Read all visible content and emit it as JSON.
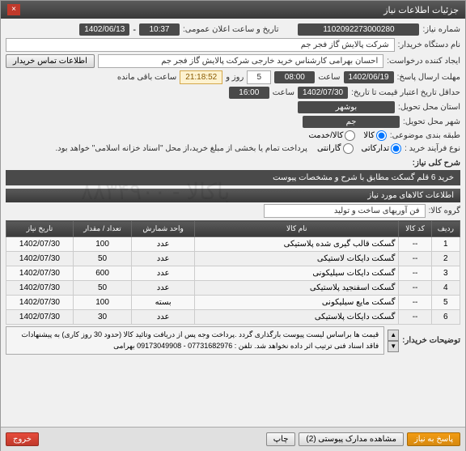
{
  "window": {
    "title": "جزئیات اطلاعات نیاز"
  },
  "top": {
    "req_no_label": "شماره نیاز:",
    "req_no": "1102092273000280",
    "announce_label": "تاریخ و ساعت اعلان عمومی:",
    "announce_time": "10:37",
    "announce_date": "1402/06/13",
    "buyer_label": "نام دستگاه خریدار:",
    "buyer": "شرکت پالایش گاز فجر جم",
    "creator_label": "ایجاد کننده درخواست:",
    "creator": "احسان بهرامی کارشناس خرید خارجی شرکت پالایش گاز فجر جم",
    "contact_btn": "اطلاعات تماس خریدار",
    "deadline_label": "مهلت ارسال پاسخ:",
    "deadline_date": "1402/06/19",
    "time_label": "ساعت",
    "deadline_time": "08:00",
    "days_label": "روز و",
    "days": "5",
    "timer": "21:18:52",
    "remain_label": "ساعت باقی مانده",
    "valid_label": "حداقل تاریخ اعتبار قیمت تا تاریخ:",
    "valid_date": "1402/07/30",
    "valid_time": "16:00",
    "province_label": "استان محل تحویل:",
    "province": "بوشهر",
    "city_label": "شهر محل تحویل:",
    "city": "جم",
    "category_label": "طبقه بندی موضوعی:",
    "cat_goods": "کالا",
    "cat_service": "کالا/خدمت",
    "purchase_type_label": "نوع فرآیند خرید :",
    "pt_bank": "",
    "pt_cash": "",
    "pay_note": "پرداخت تمام یا بخشی از مبلغ خرید،از محل \"اسناد خزانه اسلامی\" خواهد بود.",
    "radio_labels": {
      "tadarokati": "تدارکاتی",
      "garantee": "گارانتی",
      "khadmat": "خدمت",
      "kala": "کالا",
      "both": "کالا/خدمت"
    }
  },
  "desc": {
    "label": "شرح کلی نیاز:",
    "text": "خرید 6 قلم گسکت مطابق با شرح و مشخصات پیوست"
  },
  "items_hdr": "اطلاعات کالاهای مورد نیاز",
  "group": {
    "label": "گروه کالا:",
    "value": "فن آوریهای ساخت و تولید"
  },
  "table": {
    "headers": [
      "ردیف",
      "کد کالا",
      "نام کالا",
      "واحد شمارش",
      "تعداد / مقدار",
      "تاریخ نیاز"
    ],
    "rows": [
      {
        "n": "1",
        "code": "--",
        "name": "گسکت قالب گیری شده پلاستیکی",
        "unit": "عدد",
        "qty": "100",
        "date": "1402/07/30"
      },
      {
        "n": "2",
        "code": "--",
        "name": "گسکت دایکات لاستیکی",
        "unit": "عدد",
        "qty": "50",
        "date": "1402/07/30"
      },
      {
        "n": "3",
        "code": "--",
        "name": "گسکت دایکات سیلیکونی",
        "unit": "عدد",
        "qty": "600",
        "date": "1402/07/30"
      },
      {
        "n": "4",
        "code": "--",
        "name": "گسکت اسفنجید پلاستیکی",
        "unit": "عدد",
        "qty": "50",
        "date": "1402/07/30"
      },
      {
        "n": "5",
        "code": "--",
        "name": "گسکت مایع سیلیکونی",
        "unit": "بسته",
        "qty": "100",
        "date": "1402/07/30"
      },
      {
        "n": "6",
        "code": "--",
        "name": "گسکت دایکات پلاستیکی",
        "unit": "عدد",
        "qty": "30",
        "date": "1402/07/30"
      }
    ]
  },
  "notes": {
    "label": "توضیحات خریدار:",
    "text": "قیمت ها براساس لیست پیوست بارگذاری گردد .پرداخت وجه پس از دریافت وتائید کالا (حدود 30 روز کاری) به پیشنهادات فاقد اسناد فنی ترتیب اثر داده نخواهد شد. تلفن : 07731682976 - 09173049908 بهرامی"
  },
  "footer": {
    "reply": "پاسخ به نیاز",
    "attach": "مشاهده مدارک پیوستی (2)",
    "print": "چاپ",
    "exit": "خروج"
  },
  "watermark": "باکالا - ۸۸۳۴۹۰۰"
}
